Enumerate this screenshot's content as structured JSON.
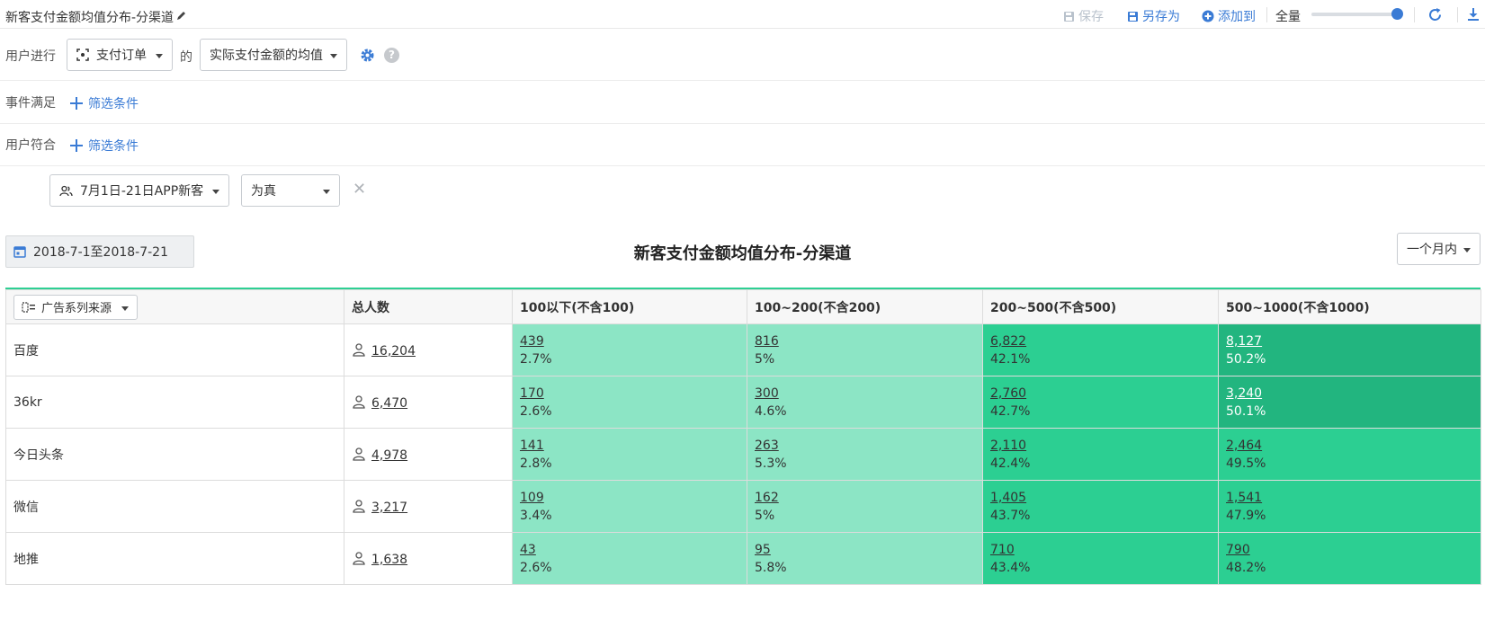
{
  "topbar": {
    "title": "新客支付金额均值分布-分渠道",
    "save_label": "保存",
    "saveas_label": "另存为",
    "addto_label": "添加到",
    "volume_label": "全量",
    "volume_level": 1.0
  },
  "filters": {
    "user_do_label": "用户进行",
    "event_select": "支付订单",
    "de": "的",
    "measure_select": "实际支付金额的均值",
    "event_cond_label": "事件满足",
    "user_cond_label": "用户符合",
    "add_condition": "筛选条件",
    "segment_select": "7月1日-21日APP新客",
    "truth_select": "为真",
    "close_glyph": "✕"
  },
  "report": {
    "date_range": "2018-7-1至2018-7-21",
    "title": "新客支付金额均值分布-分渠道",
    "period": "一个月内"
  },
  "table": {
    "group_by": "广告系列来源",
    "headers": [
      "总人数",
      "100以下(不含100)",
      "100~200(不含200)",
      "200~500(不含500)",
      "500~1000(不含1000)"
    ],
    "rows": [
      {
        "name": "百度",
        "total": "16,204",
        "cells": [
          {
            "c": "439",
            "p": "2.7%"
          },
          {
            "c": "816",
            "p": "5%"
          },
          {
            "c": "6,822",
            "p": "42.1%"
          },
          {
            "c": "8,127",
            "p": "50.2%"
          }
        ]
      },
      {
        "name": "36kr",
        "total": "6,470",
        "cells": [
          {
            "c": "170",
            "p": "2.6%"
          },
          {
            "c": "300",
            "p": "4.6%"
          },
          {
            "c": "2,760",
            "p": "42.7%"
          },
          {
            "c": "3,240",
            "p": "50.1%"
          }
        ]
      },
      {
        "name": "今日头条",
        "total": "4,978",
        "cells": [
          {
            "c": "141",
            "p": "2.8%"
          },
          {
            "c": "263",
            "p": "5.3%"
          },
          {
            "c": "2,110",
            "p": "42.4%"
          },
          {
            "c": "2,464",
            "p": "49.5%"
          }
        ]
      },
      {
        "name": "微信",
        "total": "3,217",
        "cells": [
          {
            "c": "109",
            "p": "3.4%"
          },
          {
            "c": "162",
            "p": "5%"
          },
          {
            "c": "1,405",
            "p": "43.7%"
          },
          {
            "c": "1,541",
            "p": "47.9%"
          }
        ]
      },
      {
        "name": "地推",
        "total": "1,638",
        "cells": [
          {
            "c": "43",
            "p": "2.6%"
          },
          {
            "c": "95",
            "p": "5.8%"
          },
          {
            "c": "710",
            "p": "43.4%"
          },
          {
            "c": "790",
            "p": "48.2%"
          }
        ]
      }
    ]
  },
  "colors": {
    "accent": "#3a7bd5",
    "heat_low": "#8ce5c5",
    "heat_mid": "#2ccf92",
    "heat_high": "#22b57f",
    "table_top_border": "#2ecf93"
  },
  "icons": [
    "pencil-icon",
    "save-icon",
    "saveas-icon",
    "add-circle-icon",
    "refresh-icon",
    "download-icon",
    "event-icon",
    "gear-icon",
    "help-icon",
    "plus-icon",
    "users-icon",
    "close-icon",
    "calendar-icon",
    "group-icon",
    "person-icon"
  ]
}
